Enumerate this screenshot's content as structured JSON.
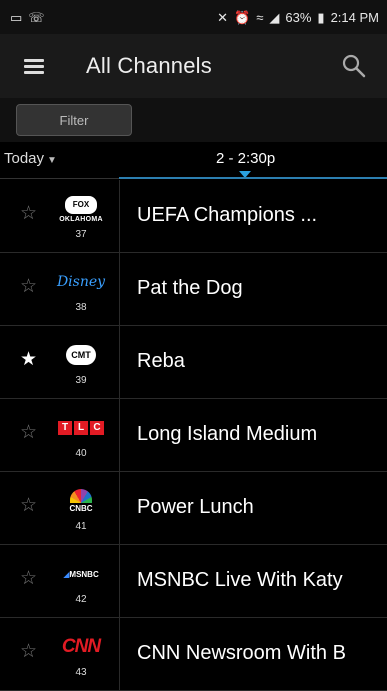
{
  "status": {
    "time": "2:14 PM",
    "battery": "63%",
    "icons": [
      "gallery-icon",
      "voicemail-icon",
      "mute-icon",
      "alarm-icon",
      "wifi-icon",
      "signal-icon",
      "battery-icon"
    ]
  },
  "header": {
    "title": "All Channels",
    "menu_icon": "hamburger-icon",
    "search_icon": "search-icon"
  },
  "filter": {
    "label": "Filter"
  },
  "timebar": {
    "day": "Today",
    "slot": "2 - 2:30p"
  },
  "channels": [
    {
      "logo": "FOX",
      "logo_sub": "OKLAHOMA",
      "number": "37",
      "program": "UEFA Champions ...",
      "favorite": false
    },
    {
      "logo": "Disney",
      "number": "38",
      "program": "Pat the Dog",
      "favorite": false
    },
    {
      "logo": "CMT",
      "number": "39",
      "program": "Reba",
      "favorite": true
    },
    {
      "logo": "TLC",
      "number": "40",
      "program": "Long Island Medium",
      "favorite": false
    },
    {
      "logo": "CNBC",
      "number": "41",
      "program": "Power Lunch",
      "favorite": false
    },
    {
      "logo": "MSNBC",
      "number": "42",
      "program": "MSNBC Live With Katy",
      "favorite": false
    },
    {
      "logo": "CNN",
      "number": "43",
      "program": "CNN Newsroom With B",
      "favorite": false
    }
  ],
  "colors": {
    "accent": "#2aa1e0",
    "background": "#000000",
    "header": "#1a1a1a"
  }
}
